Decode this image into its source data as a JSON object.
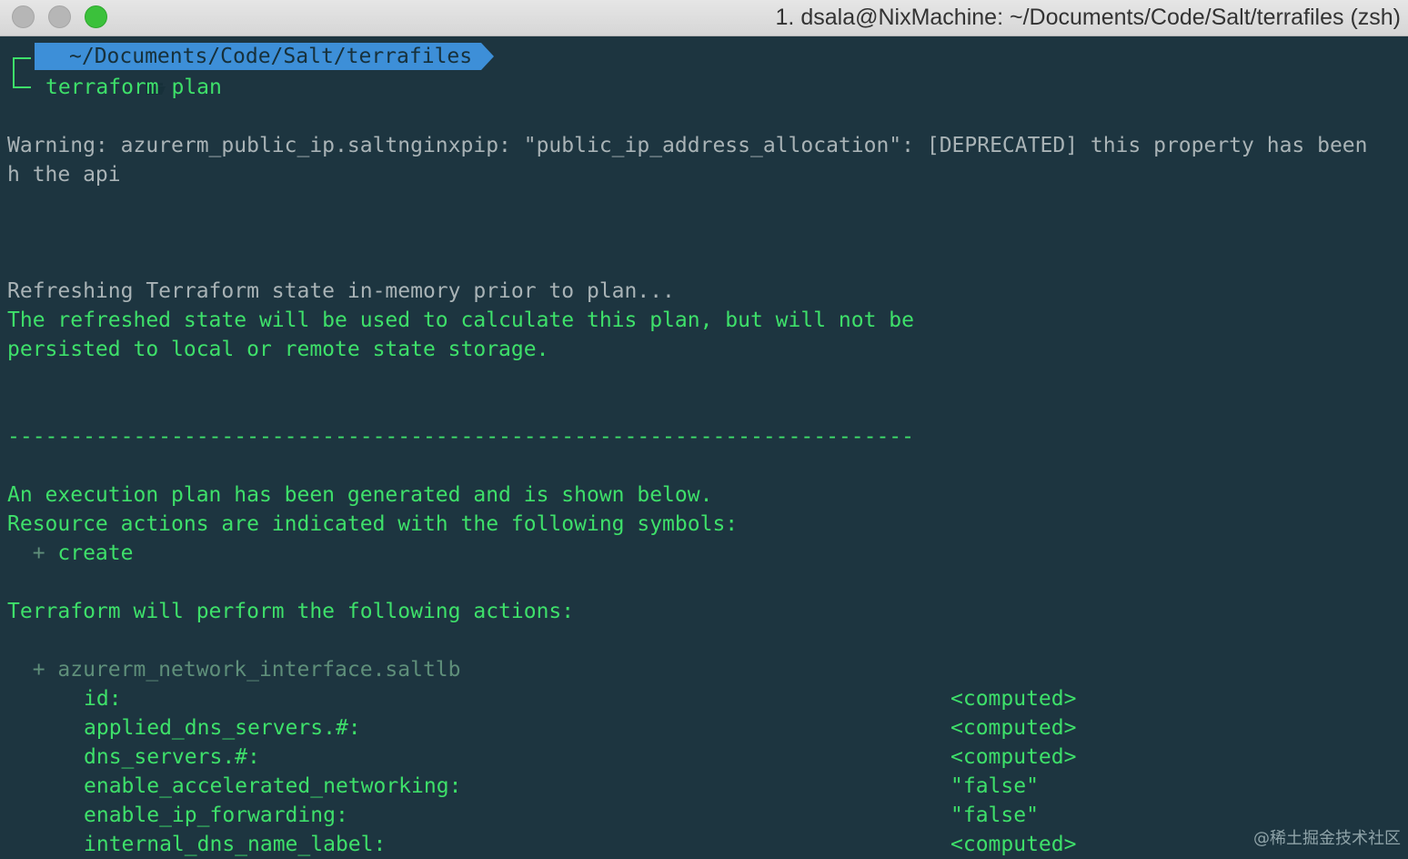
{
  "window": {
    "title": "1. dsala@NixMachine: ~/Documents/Code/Salt/terrafiles (zsh)"
  },
  "prompt": {
    "path": "~/Documents/Code/Salt/terrafiles",
    "command": "terraform plan",
    "folder_icon": "folder-open-icon"
  },
  "output": {
    "warning_label": "Warning:",
    "warning_text": " azurerm_public_ip.saltnginxpip: \"public_ip_address_allocation\": [DEPRECATED] this property has been",
    "warning_cont": "h the api",
    "refreshing": "Refreshing Terraform state in-memory prior to plan...",
    "refreshed_1": "The refreshed state will be used to calculate this plan, but will not be",
    "refreshed_2": "persisted to local or remote state storage.",
    "separator": "------------------------------------------------------------------------",
    "plan_1": "An execution plan has been generated and is shown below.",
    "plan_2": "Resource actions are indicated with the following symbols:",
    "plan_3_symbol": "  + ",
    "plan_3_text": "create",
    "actions": "Terraform will perform the following actions:",
    "resource_symbol": "  + ",
    "resource_name": "azurerm_network_interface.saltlb",
    "attributes": [
      {
        "key": "id:",
        "value": "<computed>"
      },
      {
        "key": "applied_dns_servers.#:",
        "value": "<computed>"
      },
      {
        "key": "dns_servers.#:",
        "value": "<computed>"
      },
      {
        "key": "enable_accelerated_networking:",
        "value": "\"false\""
      },
      {
        "key": "enable_ip_forwarding:",
        "value": "\"false\""
      },
      {
        "key": "internal_dns_name_label:",
        "value": "<computed>"
      }
    ]
  },
  "watermark": "@稀土掘金技术社区",
  "colors": {
    "background": "#1d3540",
    "green": "#3ee06a",
    "grey": "#a9b3b6",
    "prompt_bg": "#3d8fd8"
  }
}
